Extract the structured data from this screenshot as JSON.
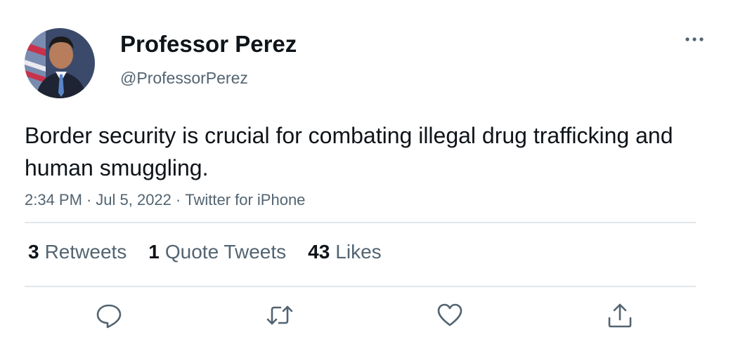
{
  "author": {
    "display_name": "Professor Perez",
    "handle": "@ProfessorPerez",
    "avatar_icon": "profile-photo"
  },
  "tweet": {
    "text": "Border security is crucial for combating illegal drug trafficking and human smuggling.",
    "time": "2:34 PM",
    "date": "Jul 5, 2022",
    "source": "Twitter for iPhone",
    "separator": "·"
  },
  "stats": {
    "retweets_count": "3",
    "retweets_label": "Retweets",
    "quote_tweets_count": "1",
    "quote_tweets_label": "Quote Tweets",
    "likes_count": "43",
    "likes_label": "Likes"
  },
  "icons": {
    "more": "more-horizontal-icon",
    "reply": "reply-icon",
    "retweet": "retweet-icon",
    "like": "heart-icon",
    "share": "share-icon"
  },
  "colors": {
    "text_primary": "#0f1419",
    "text_secondary": "#536471",
    "divider": "#e1e6ea",
    "icon": "#536471"
  }
}
